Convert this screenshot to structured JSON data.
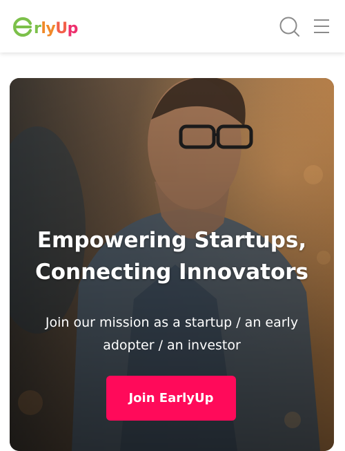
{
  "brand": {
    "logo_first": "a",
    "logo_parts": [
      "r",
      "ly",
      "U",
      "p"
    ],
    "alt": "EarlyUp",
    "colors": {
      "green": "#7cc04a",
      "orange": "#f08a2a",
      "coral": "#f2604a",
      "pink": "#ee2f6d"
    }
  },
  "header": {
    "search_icon": "search-icon",
    "menu_icon": "hamburger-menu-icon"
  },
  "hero": {
    "title_line1": "Empowering Startups,",
    "title_line2": "Connecting Innovators",
    "subtitle": "Join our mission as a startup / an early adopter / an investor",
    "cta_label": "Join EarlyUp",
    "cta_color": "#ff0a5a"
  }
}
